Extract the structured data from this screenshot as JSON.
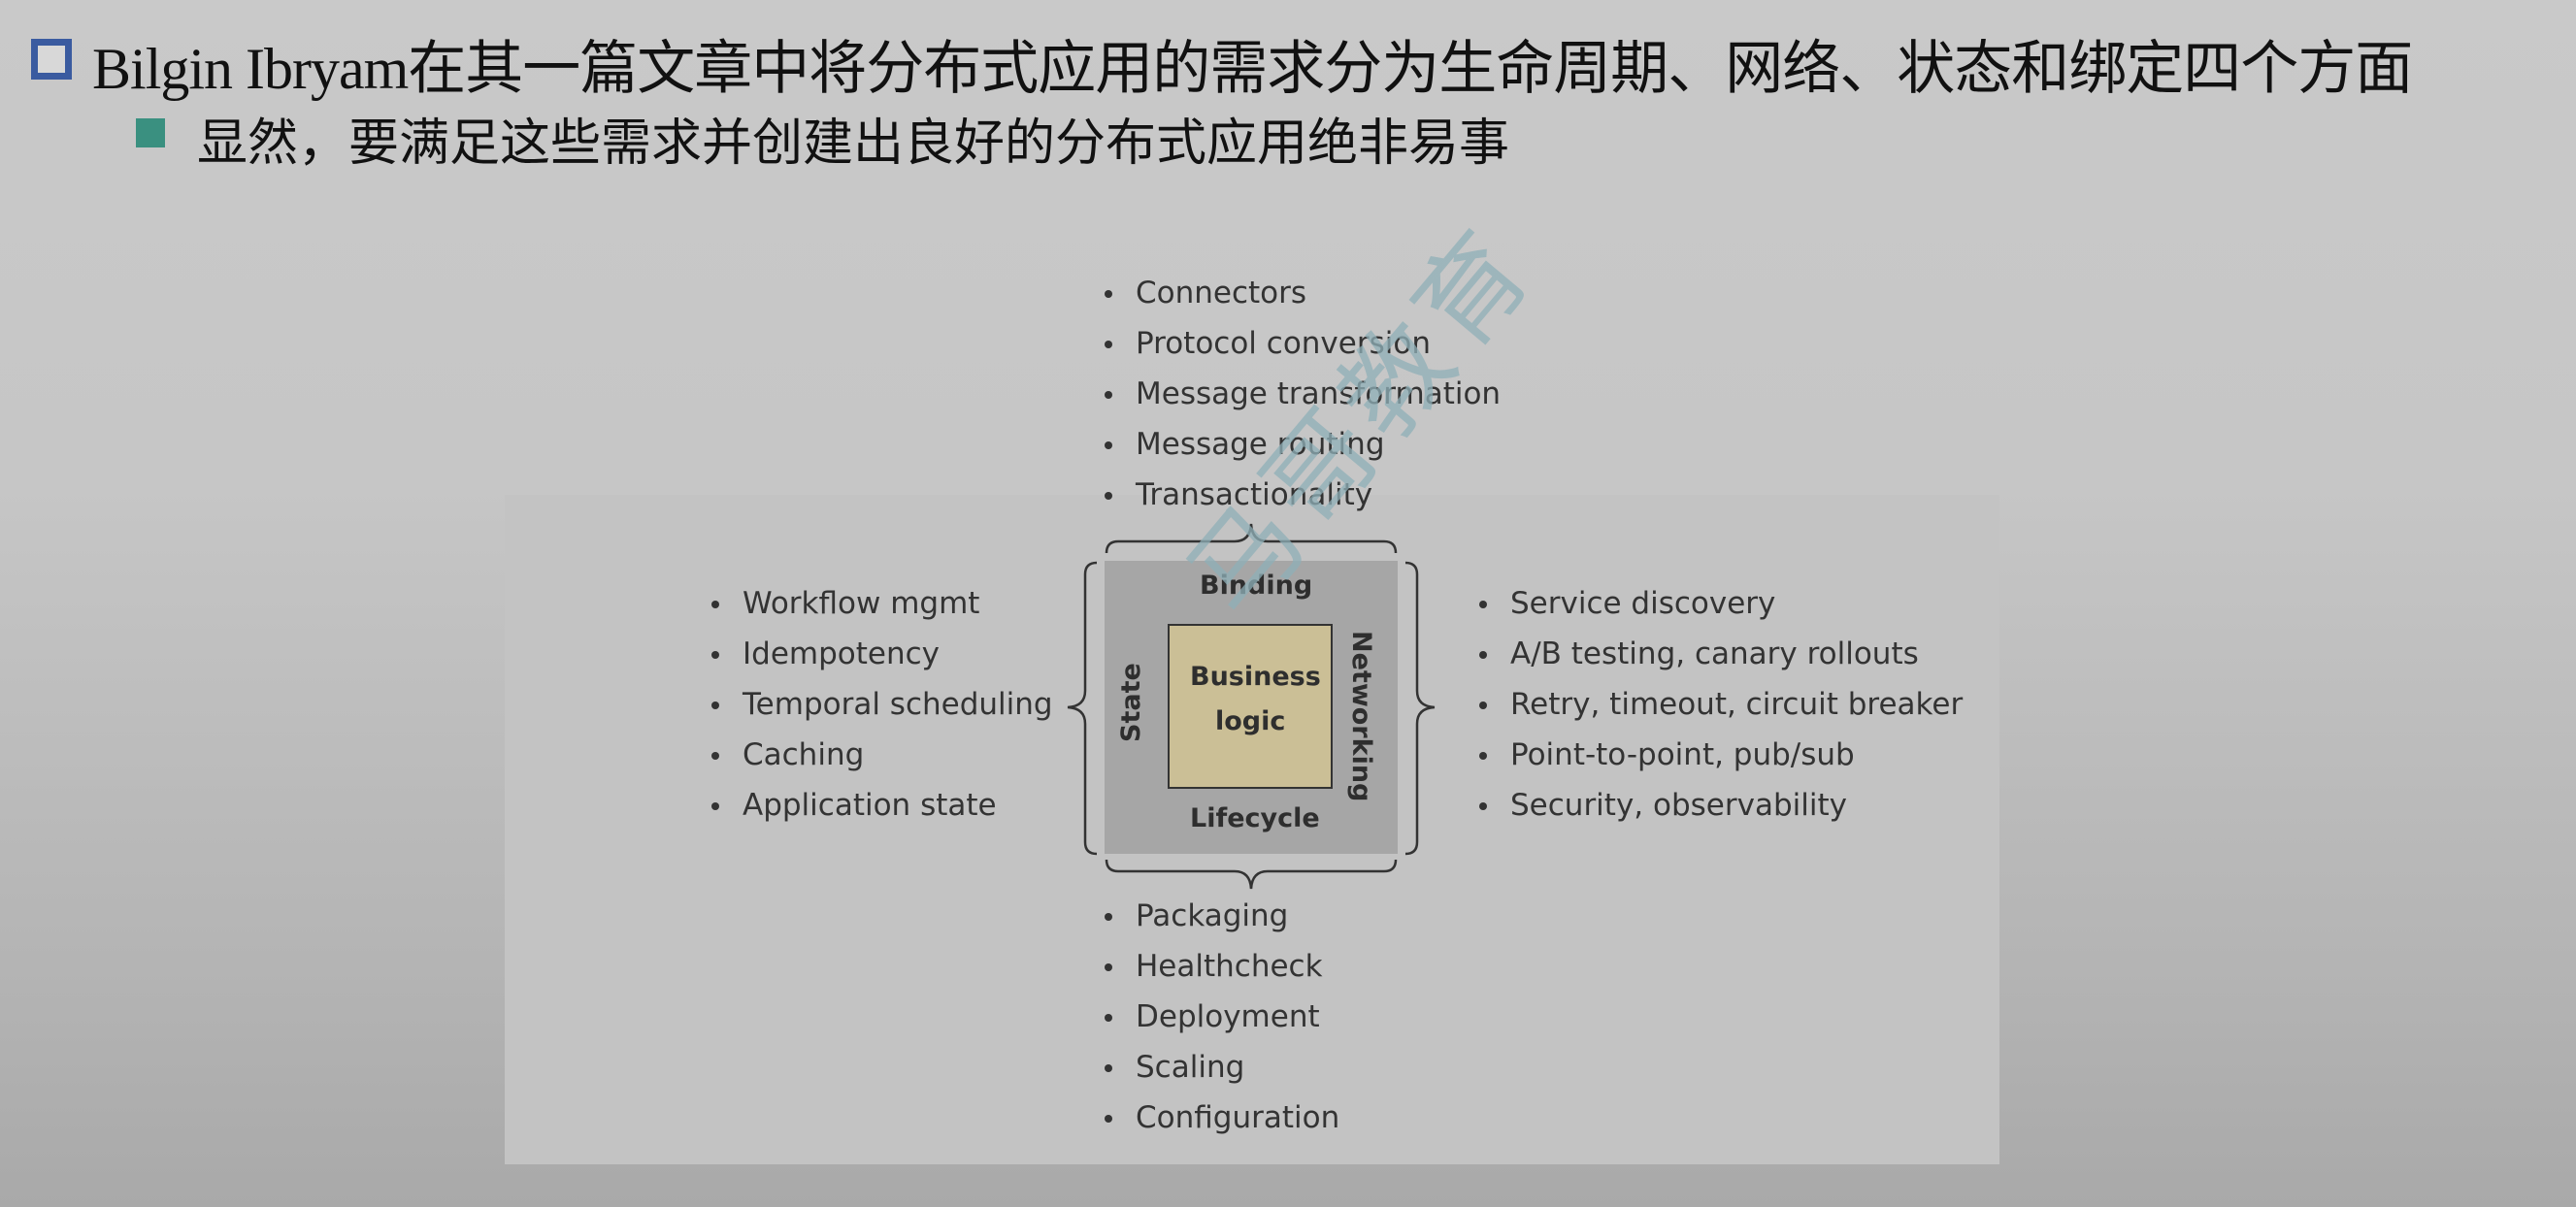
{
  "slide": {
    "title": "Bilgin Ibryam在其一篇文章中将分布式应用的需求分为生命周期、网络、状态和绑定四个方面",
    "subtitle": "显然，要满足这些需求并创建出良好的分布式应用绝非易事"
  },
  "diagram": {
    "core": "Business logic",
    "core_line1": "Business",
    "core_line2": "logic",
    "sides": {
      "top": "Binding",
      "bottom": "Lifecycle",
      "left": "State",
      "right": "Networking"
    },
    "binding_items": [
      "Connectors",
      "Protocol conversion",
      "Message transformation",
      "Message routing",
      "Transactionality"
    ],
    "state_items": [
      "Workflow mgmt",
      "Idempotency",
      "Temporal scheduling",
      "Caching",
      "Application state"
    ],
    "networking_items": [
      "Service discovery",
      "A/B testing, canary rollouts",
      "Retry, timeout, circuit breaker",
      "Point-to-point, pub/sub",
      "Security, observability"
    ],
    "lifecycle_items": [
      "Packaging",
      "Healthcheck",
      "Deployment",
      "Scaling",
      "Configuration"
    ]
  },
  "watermark": "马哥教育",
  "colors": {
    "title_bullet": "#3a5ba0",
    "sub_bullet": "#3a9080",
    "core_fill": "#cbbf96"
  }
}
